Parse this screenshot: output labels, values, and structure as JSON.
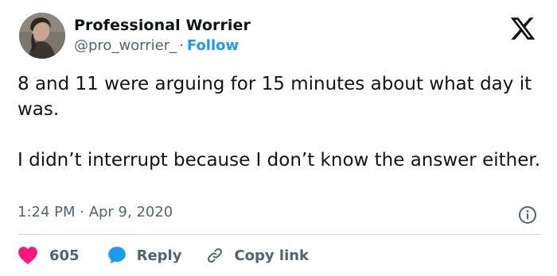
{
  "author": {
    "name": "Professional Worrier",
    "handle": "@pro_worrier_",
    "separator": "·",
    "follow_label": "Follow"
  },
  "tweet": {
    "paragraphs": [
      "8 and 11 were arguing for 15 minutes about what day it was.",
      "I didn’t interrupt because I don’t know the answer either."
    ],
    "timestamp": "1:24 PM · Apr 9, 2020"
  },
  "actions": {
    "like_count": "605",
    "reply_label": "Reply",
    "copy_label": "Copy link"
  },
  "icons": {
    "platform": "x-logo-icon",
    "like": "heart-icon",
    "reply": "speech-bubble-icon",
    "copy": "link-icon",
    "info": "info-icon"
  },
  "colors": {
    "accent": "#1d9bf0",
    "like": "#f91880",
    "secondary_text": "#536471",
    "divider": "#cfd9de"
  }
}
